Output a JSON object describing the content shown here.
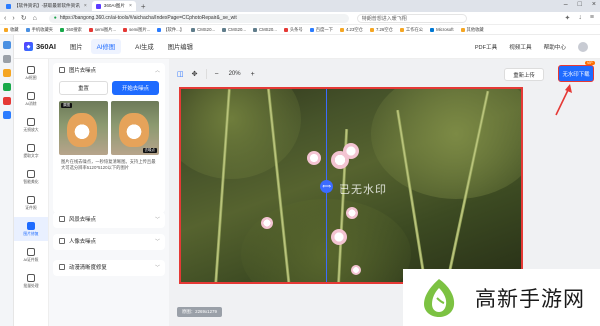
{
  "browser": {
    "tabs": [
      {
        "label": "【软件资讯】-获取最新软件资讯",
        "color": "#2b7cff"
      },
      {
        "label": "360AI图片",
        "color": "#5b3bff"
      }
    ],
    "url_prefix": "https://",
    "url": "bangong.360.cn/ai-tools/#/aichacha/IndexPage=CCphotoRepair&_se_wit",
    "search_text": "特朗普想进入暖飞翔",
    "bookmarks": [
      {
        "label": "收藏",
        "color": "#f5a623"
      },
      {
        "label": "手机收藏夹",
        "color": "#4a90e2"
      },
      {
        "label": "360搜索",
        "color": "#19a94a"
      },
      {
        "label": "semi图片...",
        "color": "#e53935"
      },
      {
        "label": "semi图片...",
        "color": "#e53935"
      },
      {
        "label": "【软件...】",
        "color": "#2b7cff"
      },
      {
        "label": "CMS20...",
        "color": "#607d8b"
      },
      {
        "label": "CMS20...",
        "color": "#607d8b"
      },
      {
        "label": "CMS20...",
        "color": "#607d8b"
      },
      {
        "label": "头条号",
        "color": "#e53935"
      },
      {
        "label": "百度一下",
        "color": "#2b7cff"
      },
      {
        "label": "4.23空仓",
        "color": "#f5a623"
      },
      {
        "label": "7.26空仓",
        "color": "#f5a623"
      },
      {
        "label": "工作在公",
        "color": "#f5a623"
      },
      {
        "label": "Microsoft",
        "color": "#0078d4"
      },
      {
        "label": "其他收藏",
        "color": "#f5a623"
      }
    ]
  },
  "app": {
    "logo_text": "360AI",
    "nav": [
      "图片",
      "AI修图",
      "AI生成",
      "图片编辑"
    ],
    "right": [
      "PDF工具",
      "视频工具",
      "帮助中心"
    ]
  },
  "sidenav": [
    {
      "label": "AI抠图"
    },
    {
      "label": "AI消除"
    },
    {
      "label": "无损放大"
    },
    {
      "label": "提取文字"
    },
    {
      "label": "智能美化"
    },
    {
      "label": "证件照"
    },
    {
      "label": "图片修复"
    },
    {
      "label": "AI证件照"
    },
    {
      "label": "批量处理"
    }
  ],
  "panel": {
    "title": "图片去噪点",
    "reset": "重置",
    "start": "开始去噪点",
    "preview_before": "原图",
    "preview_after": "去噪点",
    "description": "图片在线去噪点，一秒恢复清晰图。支持上传且最大可选分辨率5120*5120以下的图片",
    "sections": [
      "风景去噪点",
      "人像去噪点",
      "动漫清晰度修复"
    ]
  },
  "toolbar": {
    "zoom": "20%",
    "reupload": "重新上传",
    "download": "无水印下载",
    "vip": "VIP"
  },
  "canvas": {
    "watermark": "已无水印",
    "size_badge": "原图：2269x1279"
  },
  "brand": {
    "text": "高新手游网"
  }
}
